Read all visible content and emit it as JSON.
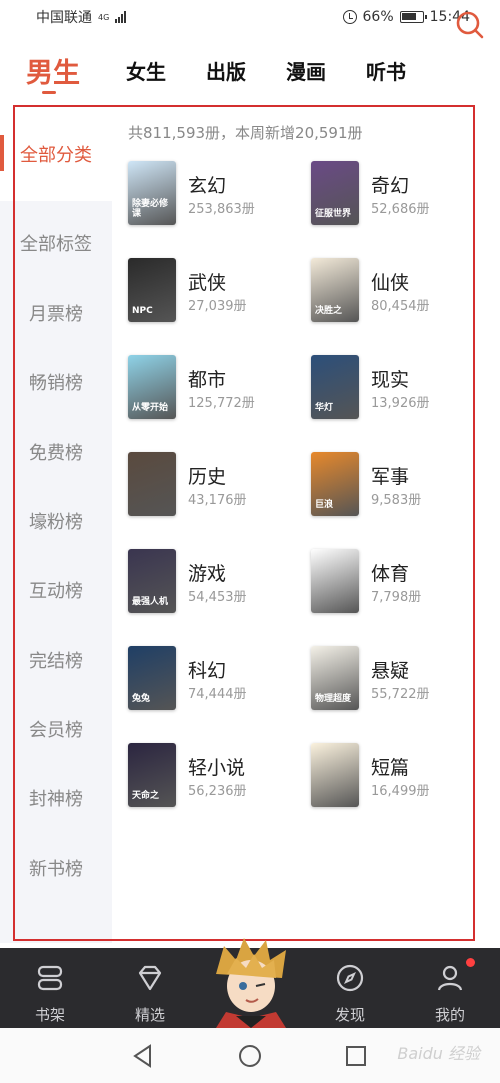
{
  "status": {
    "carrier": "中国联通",
    "network": "4G",
    "battery_pct": "66%",
    "time": "15:44"
  },
  "top_tabs": [
    "男生",
    "女生",
    "出版",
    "漫画",
    "听书"
  ],
  "sidebar": [
    "全部分类",
    "全部标签",
    "月票榜",
    "畅销榜",
    "免费榜",
    "壕粉榜",
    "互动榜",
    "完结榜",
    "会员榜",
    "封神榜",
    "新书榜"
  ],
  "summary": "共811,593册，本周新增20,591册",
  "categories": [
    {
      "name": "玄幻",
      "count": "253,863册",
      "cover_text": "除妻必修课",
      "cover_color": "#cfe6f7"
    },
    {
      "name": "奇幻",
      "count": "52,686册",
      "cover_text": "征服世界",
      "cover_color": "#6a4a86"
    },
    {
      "name": "武侠",
      "count": "27,039册",
      "cover_text": "NPC",
      "cover_color": "#2a2a2a"
    },
    {
      "name": "仙侠",
      "count": "80,454册",
      "cover_text": "决胜之",
      "cover_color": "#f3ead9"
    },
    {
      "name": "都市",
      "count": "125,772册",
      "cover_text": "从零开始",
      "cover_color": "#8fd3e8"
    },
    {
      "name": "现实",
      "count": "13,926册",
      "cover_text": "华灯",
      "cover_color": "#2c4f7a"
    },
    {
      "name": "历史",
      "count": "43,176册",
      "cover_text": "",
      "cover_color": "#5a4a3e"
    },
    {
      "name": "军事",
      "count": "9,583册",
      "cover_text": "巨浪",
      "cover_color": "#e7892c"
    },
    {
      "name": "游戏",
      "count": "54,453册",
      "cover_text": "最强人机",
      "cover_color": "#3a3550"
    },
    {
      "name": "体育",
      "count": "7,798册",
      "cover_text": "",
      "cover_color": "#ffffff"
    },
    {
      "name": "科幻",
      "count": "74,444册",
      "cover_text": "兔兔",
      "cover_color": "#1f3f66"
    },
    {
      "name": "悬疑",
      "count": "55,722册",
      "cover_text": "物理超度",
      "cover_color": "#f4f1e8"
    },
    {
      "name": "轻小说",
      "count": "56,236册",
      "cover_text": "天命之",
      "cover_color": "#2b2540"
    },
    {
      "name": "短篇",
      "count": "16,499册",
      "cover_text": "",
      "cover_color": "#fbf2de"
    }
  ],
  "bottom_nav": [
    "书架",
    "精选",
    "发现",
    "我的"
  ],
  "watermark": "Baidu 经验",
  "colors": {
    "accent": "#e05a3e",
    "outline": "#d42f2f",
    "nav_bg": "#2b2b2e"
  }
}
